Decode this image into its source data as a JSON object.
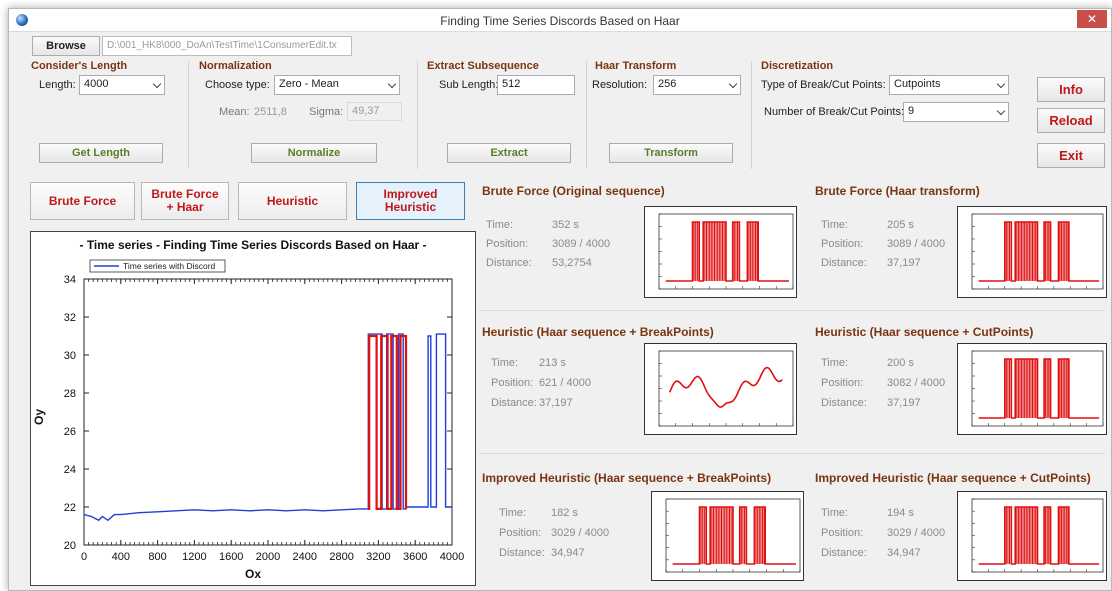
{
  "window": {
    "title": "Finding Time Series Discords Based on Haar",
    "close": "✕"
  },
  "toolbar": {
    "browse_label": "Browse",
    "path_value": "D:\\001_HK8\\000_DoAn\\TestTime\\1ConsumerEdit.tx"
  },
  "consider_length": {
    "title": "Consider's Length",
    "length_label": "Length:",
    "length_value": "4000",
    "get_length_label": "Get Length"
  },
  "normalization": {
    "title": "Normalization",
    "choose_type_label": "Choose type:",
    "type_value": "Zero - Mean",
    "mean_label": "Mean:",
    "mean_value": "2511,8",
    "sigma_label": "Sigma:",
    "sigma_value": "49,37",
    "normalize_label": "Normalize"
  },
  "extract": {
    "title": "Extract Subsequence",
    "sub_length_label": "Sub Length:",
    "sub_length_value": "512",
    "extract_label": "Extract"
  },
  "haar": {
    "title": "Haar Transform",
    "resolution_label": "Resolution:",
    "resolution_value": "256",
    "transform_label": "Transform"
  },
  "discretization": {
    "title": "Discretization",
    "type_label": "Type of Break/Cut Points:",
    "type_value": "Cutpoints",
    "number_label": "Number of Break/Cut Points:",
    "number_value": "9"
  },
  "side_buttons": {
    "info": "Info",
    "reload": "Reload",
    "exit": "Exit"
  },
  "algorithms": {
    "brute_force": "Brute Force",
    "brute_force_haar_1": "Brute Force",
    "brute_force_haar_2": "+ Haar",
    "heuristic": "Heuristic",
    "improved_1": "Improved",
    "improved_2": "Heuristic"
  },
  "colors": {
    "accent_red": "#c0181a",
    "series_blue": "#1f3fd6",
    "discord_red": "#e01010",
    "title_brown": "#7a3410"
  },
  "chart_data": {
    "type": "line",
    "title": "- Time series - Finding Time Series Discords Based on Haar -",
    "xlabel": "Ox",
    "ylabel": "Oy",
    "xlim": [
      0,
      4000
    ],
    "ylim": [
      20,
      34
    ],
    "x_ticks": [
      "0",
      "400",
      "800",
      "1200",
      "1600",
      "2000",
      "2400",
      "2800",
      "3200",
      "3600",
      "4000"
    ],
    "y_ticks": [
      "20",
      "22",
      "24",
      "26",
      "28",
      "30",
      "32",
      "34"
    ],
    "legend": [
      "Time series with Discord"
    ],
    "legend_placement": "top-left",
    "series": [
      {
        "name": "Time series with Discord",
        "color": "#1f3fd6",
        "x": [
          0,
          80,
          160,
          200,
          260,
          330,
          400,
          600,
          800,
          1000,
          1200,
          1400,
          1600,
          1800,
          2000,
          2200,
          2400,
          2600,
          2800,
          3000,
          3090,
          3090,
          3240,
          3240,
          3290,
          3290,
          3360,
          3360,
          3420,
          3420,
          3470,
          3470,
          3500,
          3500,
          3740,
          3740,
          3770,
          3770,
          3830,
          3830,
          3930,
          3930,
          4000
        ],
        "y": [
          21.6,
          21.5,
          21.3,
          21.5,
          21.3,
          21.6,
          21.6,
          21.7,
          21.75,
          21.8,
          21.85,
          21.8,
          21.85,
          21.8,
          21.85,
          21.8,
          21.85,
          21.8,
          21.85,
          21.9,
          21.9,
          31.1,
          31.1,
          21.9,
          21.9,
          31.1,
          31.1,
          21.9,
          21.9,
          31.1,
          31.1,
          21.9,
          21.9,
          22.0,
          22.0,
          31.0,
          31.0,
          22.0,
          22.0,
          31.1,
          31.1,
          22.0,
          22.0
        ]
      },
      {
        "name": "Discord",
        "color": "#e01010",
        "x": [
          3089,
          3100,
          3100,
          3180,
          3180,
          3230,
          3230,
          3300,
          3300,
          3340,
          3340,
          3400,
          3400,
          3440,
          3440,
          3500,
          3500
        ],
        "y": [
          21.9,
          21.9,
          31.0,
          31.0,
          21.9,
          21.9,
          31.0,
          31.0,
          21.9,
          21.9,
          31.0,
          31.0,
          21.9,
          21.9,
          31.0,
          31.0,
          21.9
        ]
      }
    ]
  },
  "panels": {
    "bf": {
      "title": "Brute Force (Original sequence)",
      "time_label": "Time:",
      "time": "352 s",
      "position_label": "Position:",
      "position": "3089 / 4000",
      "distance_label": "Distance:",
      "distance": "53,2754"
    },
    "bfh": {
      "title": "Brute Force (Haar transform)",
      "time_label": "Time:",
      "time": "205 s",
      "position_label": "Position:",
      "position": "3089 / 4000",
      "distance_label": "Distance:",
      "distance": "37,197"
    },
    "hb": {
      "title": "Heuristic (Haar sequence + BreakPoints)",
      "time_label": "Time:",
      "time": "213 s",
      "position_label": "Position:",
      "position": "621 / 4000",
      "distance_label": "Distance:",
      "distance": "37,197"
    },
    "hc": {
      "title": "Heuristic (Haar sequence + CutPoints)",
      "time_label": "Time:",
      "time": "200 s",
      "position_label": "Position:",
      "position": "3082 / 4000",
      "distance_label": "Distance:",
      "distance": "37,197"
    },
    "ihb": {
      "title": "Improved Heuristic (Haar sequence + BreakPoints)",
      "time_label": "Time:",
      "time": "182 s",
      "position_label": "Position:",
      "position": "3029 / 4000",
      "distance_label": "Distance:",
      "distance": "34,947"
    },
    "ihc": {
      "title": "Improved Heuristic (Haar sequence + CutPoints)",
      "time_label": "Time:",
      "time": "194 s",
      "position_label": "Position:",
      "position": "3029 / 4000",
      "distance_label": "Distance:",
      "distance": "34,947"
    }
  }
}
